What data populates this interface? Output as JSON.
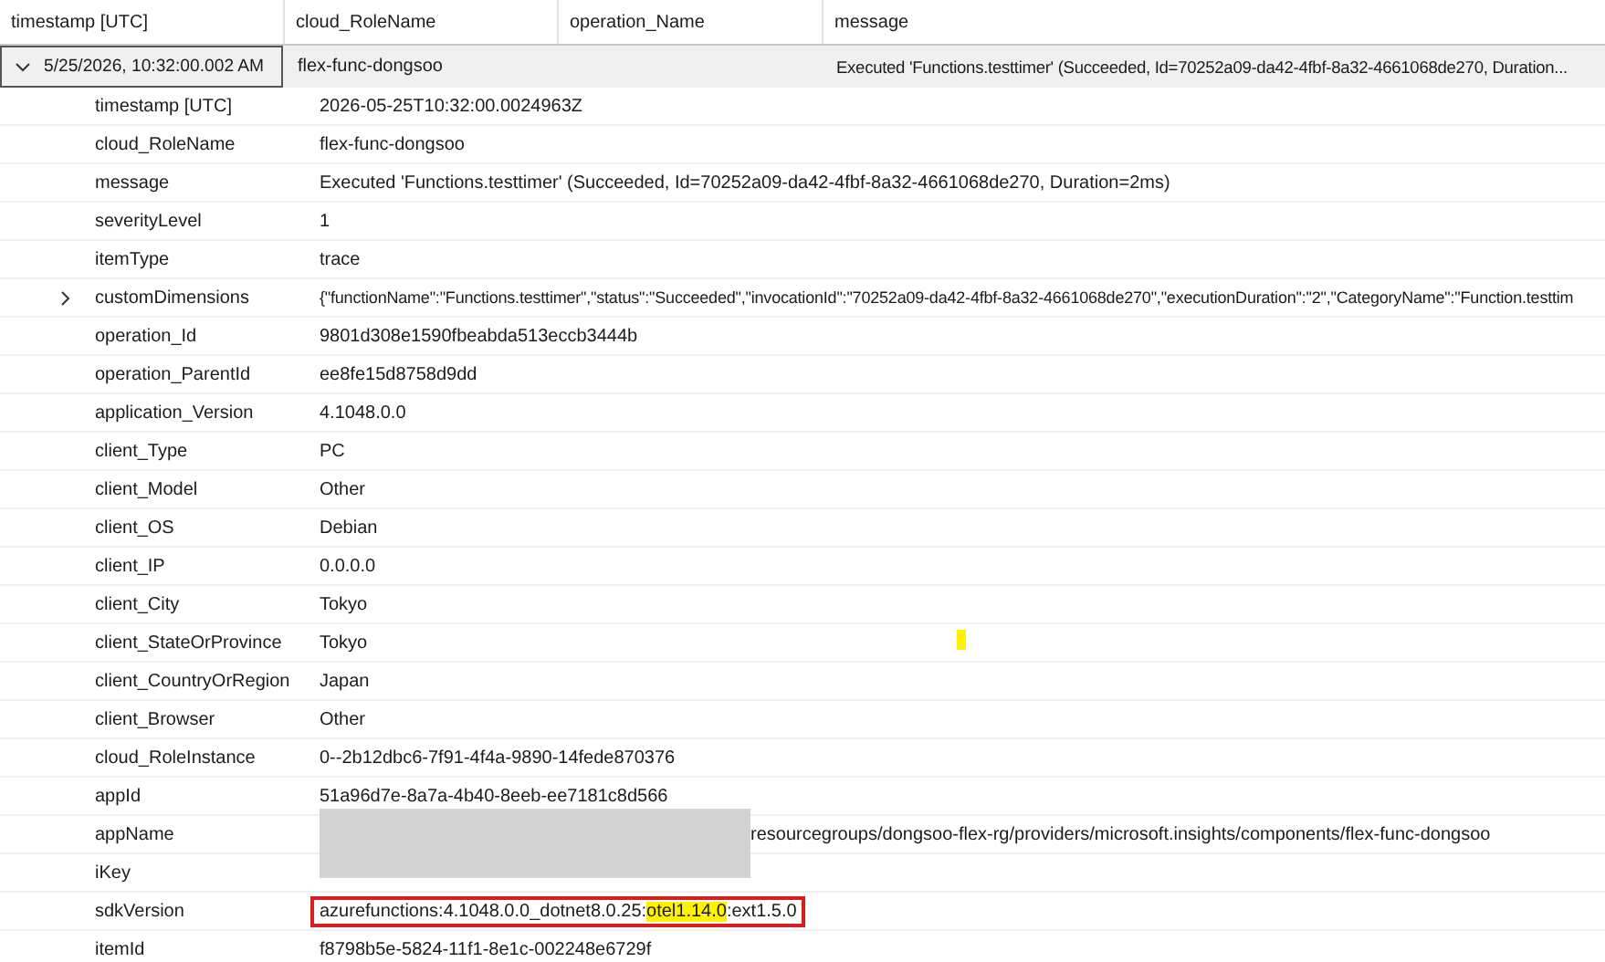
{
  "columns": [
    "timestamp [UTC]",
    "cloud_RoleName",
    "operation_Name",
    "message"
  ],
  "record": {
    "expanded": true,
    "selected": true,
    "timestamp": "5/25/2026, 10:32:00.002 AM",
    "cloud_RoleName": "flex-func-dongsoo",
    "message": "Executed 'Functions.testtimer' (Succeeded, Id=70252a09-da42-4fbf-8a32-4661068de270, Duration..."
  },
  "fields": [
    {
      "name": "timestamp [UTC]",
      "value": "2026-05-25T10:32:00.0024963Z"
    },
    {
      "name": "cloud_RoleName",
      "value": "flex-func-dongsoo"
    },
    {
      "name": "message",
      "value": "Executed 'Functions.testtimer' (Succeeded, Id=70252a09-da42-4fbf-8a32-4661068de270, Duration=2ms)"
    },
    {
      "name": "severityLevel",
      "value": "1"
    },
    {
      "name": "itemType",
      "value": "trace"
    },
    {
      "name": "customDimensions",
      "value": "{\"functionName\":\"Functions.testtimer\",\"status\":\"Succeeded\",\"invocationId\":\"70252a09-da42-4fbf-8a32-4661068de270\",\"executionDuration\":\"2\",\"CategoryName\":\"Function.testtim",
      "expandable": true,
      "expanded": false
    },
    {
      "name": "operation_Id",
      "value": "9801d308e1590fbeabda513eccb3444b"
    },
    {
      "name": "operation_ParentId",
      "value": "ee8fe15d8758d9dd"
    },
    {
      "name": "application_Version",
      "value": "4.1048.0.0"
    },
    {
      "name": "client_Type",
      "value": "PC"
    },
    {
      "name": "client_Model",
      "value": "Other"
    },
    {
      "name": "client_OS",
      "value": "Debian"
    },
    {
      "name": "client_IP",
      "value": "0.0.0.0"
    },
    {
      "name": "client_City",
      "value": "Tokyo"
    },
    {
      "name": "client_StateOrProvince",
      "value": "Tokyo",
      "highlight_mark": true
    },
    {
      "name": "client_CountryOrRegion",
      "value": "Japan"
    },
    {
      "name": "client_Browser",
      "value": "Other"
    },
    {
      "name": "cloud_RoleInstance",
      "value": "0--2b12dbc6-7f91-4f4a-9890-14fede870376"
    },
    {
      "name": "appId",
      "value": "51a96d7e-8a7a-4b40-8eeb-ee7181c8d566"
    },
    {
      "name": "appName",
      "value": "resourcegroups/dongsoo-flex-rg/providers/microsoft.insights/components/flex-func-dongsoo",
      "redacted": true
    },
    {
      "name": "iKey"
    },
    {
      "name": "sdkVersion",
      "boxed": true,
      "value_parts": [
        {
          "text": "azurefunctions:4.1048.0.0_dotnet8.0.25:",
          "highlighted": false
        },
        {
          "text": "otel1.14.0",
          "highlighted": true
        },
        {
          "text": ":ext1.5.0",
          "highlighted": false
        }
      ]
    },
    {
      "name": "itemId",
      "value": "f8798b5e-5824-11f1-8e1c-002248e6729f"
    }
  ]
}
